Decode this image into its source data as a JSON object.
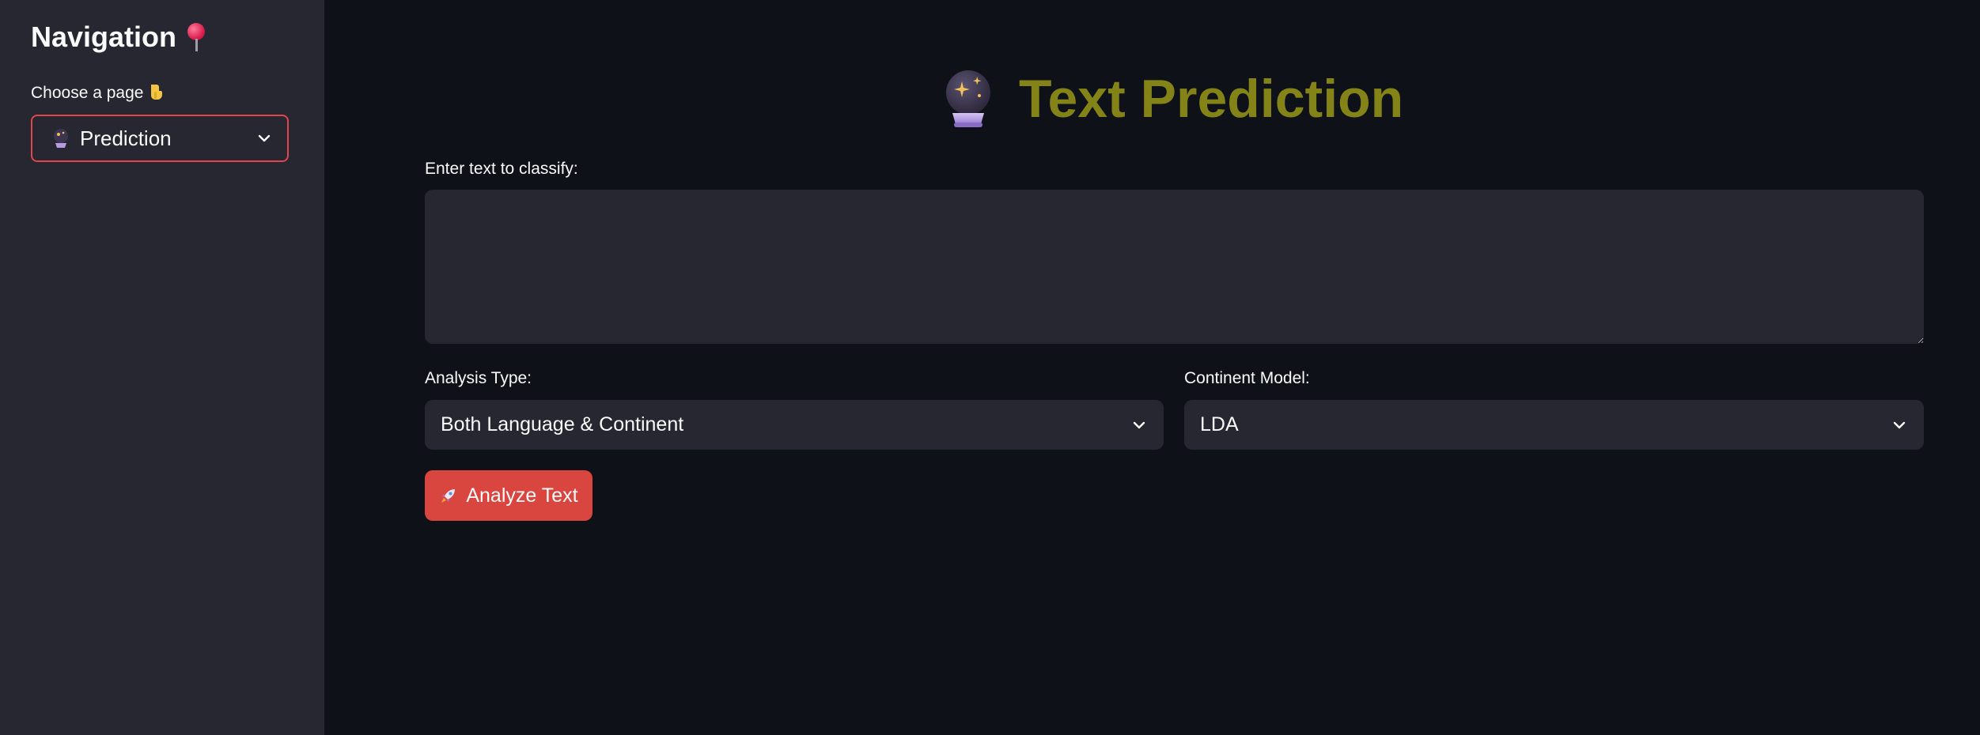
{
  "sidebar": {
    "title": "Navigation",
    "title_icon": "round-pushpin-icon",
    "choose_label": "Choose a page",
    "choose_icon": "pointing-down-icon",
    "page_select": {
      "icon": "crystal-ball-icon",
      "value": "Prediction"
    }
  },
  "main": {
    "title": "Text Prediction",
    "title_icon": "crystal-ball-icon",
    "text_input": {
      "label": "Enter text to classify:",
      "value": ""
    },
    "analysis_type": {
      "label": "Analysis Type:",
      "value": "Both Language & Continent"
    },
    "continent_model": {
      "label": "Continent Model:",
      "value": "LDA"
    },
    "analyze_button": {
      "label": "Analyze Text",
      "icon": "rocket-icon"
    }
  },
  "colors": {
    "background": "#0e1117",
    "sidebar": "#262730",
    "input": "#262730",
    "title": "#848317",
    "accent": "#d9453f",
    "focus_border": "#e0474c"
  }
}
